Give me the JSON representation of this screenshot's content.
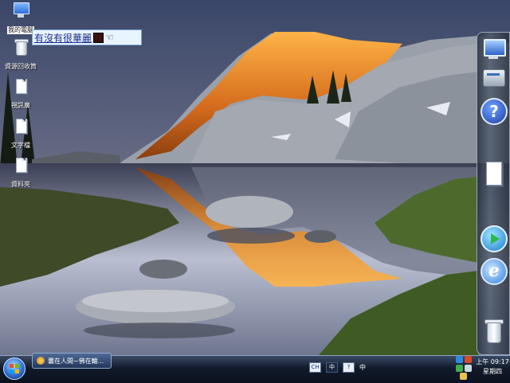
{
  "desktop": {
    "icons": [
      {
        "label": "我的電腦",
        "icon": "computer-icon",
        "selected": true
      },
      {
        "label": "資源回收筒",
        "icon": "recycle-bin-icon"
      },
      {
        "label": "視訊廣",
        "icon": "document-icon"
      },
      {
        "label": "文字檔",
        "icon": "document-icon"
      },
      {
        "label": "資料夾",
        "icon": "document-icon"
      }
    ]
  },
  "ime_toolbar": {
    "text": "有沒有很華麗"
  },
  "taskbar": {
    "window_button_label": "囊在人間~佛在輪...",
    "language_keys": [
      "CH",
      "中",
      "?",
      "中"
    ],
    "clock": {
      "time": "上午 09:17",
      "day": "星期四"
    }
  },
  "colors": {
    "taskbar": "#111a2a",
    "accent": "#2d6fd6",
    "ime_text": "#1a2a8a"
  }
}
